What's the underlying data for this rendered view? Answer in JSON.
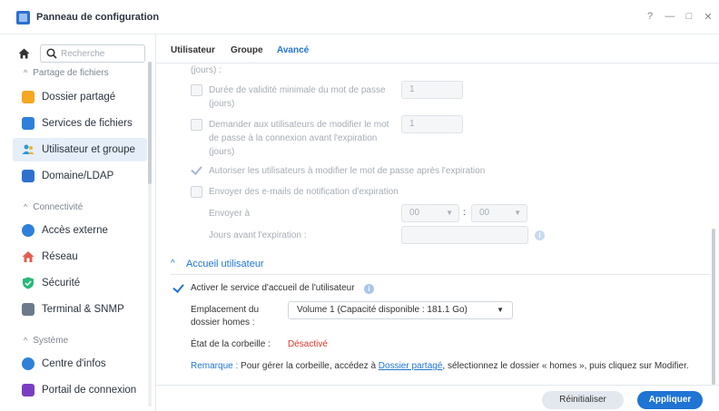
{
  "window": {
    "title": "Panneau de configuration",
    "controls": [
      "?",
      "—",
      "□",
      "✕"
    ]
  },
  "sidebar": {
    "search_placeholder": "Recherche",
    "sections": [
      {
        "label": "Partage de fichiers",
        "items": [
          {
            "label": "Dossier partagé",
            "icon": "folder-icon",
            "color": "#f5a623"
          },
          {
            "label": "Services de fichiers",
            "icon": "file-services-icon",
            "color": "#2f80d8"
          },
          {
            "label": "Utilisateur et groupe",
            "icon": "users-icon",
            "color": "#2a9ad6",
            "active": true
          },
          {
            "label": "Domaine/LDAP",
            "icon": "domain-icon",
            "color": "#2f6fd0"
          }
        ]
      },
      {
        "label": "Connectivité",
        "items": [
          {
            "label": "Accès externe",
            "icon": "external-access-icon",
            "color": "#2f80d8"
          },
          {
            "label": "Réseau",
            "icon": "network-home-icon",
            "color": "#e35d4f"
          },
          {
            "label": "Sécurité",
            "icon": "shield-icon",
            "color": "#29b77a"
          },
          {
            "label": "Terminal & SNMP",
            "icon": "terminal-icon",
            "color": "#6c7a8c"
          }
        ]
      },
      {
        "label": "Système",
        "items": [
          {
            "label": "Centre d'infos",
            "icon": "info-center-icon",
            "color": "#2f80d8"
          },
          {
            "label": "Portail de connexion",
            "icon": "login-portal-icon",
            "color": "#7a3fc0"
          }
        ]
      }
    ]
  },
  "tabs": [
    {
      "label": "Utilisateur",
      "active": false
    },
    {
      "label": "Groupe",
      "active": false
    },
    {
      "label": "Avancé",
      "active": true
    }
  ],
  "password_settings": {
    "partial_label": "(jours) :",
    "min_validity": {
      "label_1": "Durée de validité minimale du mot de passe",
      "label_2": "(jours)",
      "value": "1",
      "checked": false
    },
    "ask_change": {
      "label_1": "Demander aux utilisateurs de modifier le mot",
      "label_2": "de passe à la connexion avant l'expiration",
      "label_3": "(jours)",
      "value": "1",
      "checked": false
    },
    "allow_change": {
      "label": "Autoriser les utilisateurs à modifier le mot de passe après l'expiration",
      "checked": true
    },
    "email_notify": {
      "label": "Envoyer des e-mails de notification d'expiration",
      "checked": false
    },
    "send_at": {
      "label": "Envoyer à",
      "hour": "00",
      "separator": ":",
      "minute": "00"
    },
    "days_before": {
      "label": "Jours avant l'expiration :",
      "value": ""
    }
  },
  "user_home": {
    "section_title": "Accueil utilisateur",
    "enable": {
      "label": "Activer le service d'accueil de l'utilisateur",
      "checked": true
    },
    "location": {
      "label_1": "Emplacement du",
      "label_2": "dossier homes :",
      "value": "Volume 1 (Capacité disponible : 181.1 Go)"
    },
    "recycle": {
      "label": "État de la corbeille :",
      "value": "Désactivé",
      "value_color": "#e0352b"
    },
    "note": {
      "prefix": "Remarque :",
      "text_1": "Pour gérer la corbeille, accédez à",
      "link": "Dossier partagé",
      "text_2": ", sélectionnez le dossier « homes », puis cliquez sur Modifier."
    }
  },
  "footer": {
    "reset_label": "Réinitialiser",
    "apply_label": "Appliquer"
  },
  "colors": {
    "accent": "#1f74d4",
    "disabled_text": "#a6adb5",
    "active_nav_bg": "#e6eef9"
  }
}
